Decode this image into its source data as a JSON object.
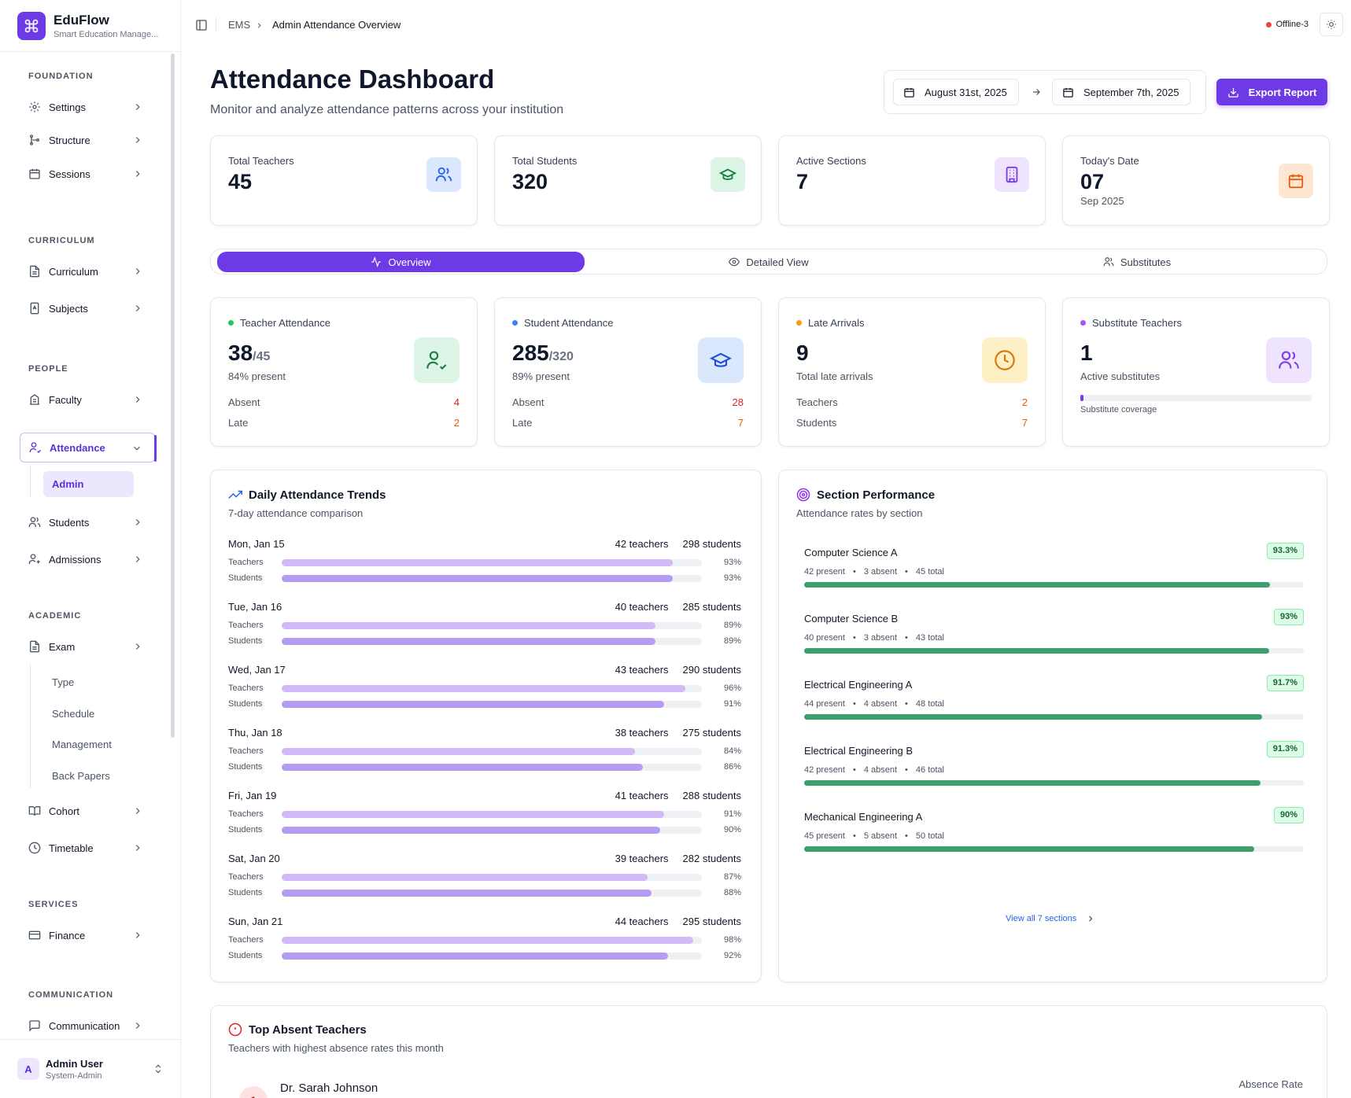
{
  "brand": {
    "name": "EduFlow",
    "subtitle": "Smart Education Manage..."
  },
  "sidebar": {
    "groups": [
      "FOUNDATION",
      "CURRICULUM",
      "PEOPLE",
      "ACADEMIC",
      "SERVICES",
      "COMMUNICATION"
    ],
    "items": {
      "settings": "Settings",
      "structure": "Structure",
      "sessions": "Sessions",
      "curriculum": "Curriculum",
      "subjects": "Subjects",
      "faculty": "Faculty",
      "attendance": "Attendance",
      "attendance_admin": "Admin",
      "students": "Students",
      "admissions": "Admissions",
      "exam": "Exam",
      "exam_type": "Type",
      "exam_schedule": "Schedule",
      "exam_management": "Management",
      "exam_back_papers": "Back Papers",
      "cohort": "Cohort",
      "timetable": "Timetable",
      "finance": "Finance",
      "communication": "Communication"
    },
    "user": {
      "initial": "A",
      "name": "Admin User",
      "role": "System-Admin"
    }
  },
  "topbar": {
    "breadcrumb": [
      "EMS",
      "Admin Attendance Overview"
    ],
    "status": "Offline-3"
  },
  "header": {
    "title": "Attendance Dashboard",
    "subtitle": "Monitor and analyze attendance patterns across your institution",
    "date_from": "August 31st, 2025",
    "date_to": "September 7th, 2025",
    "export_label": "Export Report"
  },
  "stats": [
    {
      "label": "Total Teachers",
      "value": "45"
    },
    {
      "label": "Total Students",
      "value": "320"
    },
    {
      "label": "Active Sections",
      "value": "7"
    },
    {
      "label": "Today's Date",
      "value": "07",
      "sub": "Sep 2025"
    }
  ],
  "tabs": [
    "Overview",
    "Detailed View",
    "Substitutes"
  ],
  "metrics": {
    "teacher": {
      "title": "Teacher Attendance",
      "value": "38",
      "total": "/45",
      "pct": "84% present",
      "absent_label": "Absent",
      "absent": "4",
      "late_label": "Late",
      "late": "2"
    },
    "student": {
      "title": "Student Attendance",
      "value": "285",
      "total": "/320",
      "pct": "89% present",
      "absent_label": "Absent",
      "absent": "28",
      "late_label": "Late",
      "late": "7"
    },
    "late": {
      "title": "Late Arrivals",
      "value": "9",
      "sub": "Total late arrivals",
      "teachers_label": "Teachers",
      "teachers": "2",
      "students_label": "Students",
      "students": "7"
    },
    "subs": {
      "title": "Substitute Teachers",
      "value": "1",
      "sub": "Active substitutes",
      "coverage_label": "Substitute coverage",
      "coverage": 0.012
    }
  },
  "trends": {
    "title": "Daily Attendance Trends",
    "subtitle": "7-day attendance comparison",
    "teachers_label": "Teachers",
    "students_label": "Students",
    "days": [
      {
        "day": "Mon, Jan 15",
        "teachers": "42 teachers",
        "students": "298 students",
        "tpct": 93,
        "spct": 93,
        "tpct_l": "93%",
        "spct_l": "93%"
      },
      {
        "day": "Tue, Jan 16",
        "teachers": "40 teachers",
        "students": "285 students",
        "tpct": 89,
        "spct": 89,
        "tpct_l": "89%",
        "spct_l": "89%"
      },
      {
        "day": "Wed, Jan 17",
        "teachers": "43 teachers",
        "students": "290 students",
        "tpct": 96,
        "spct": 91,
        "tpct_l": "96%",
        "spct_l": "91%"
      },
      {
        "day": "Thu, Jan 18",
        "teachers": "38 teachers",
        "students": "275 students",
        "tpct": 84,
        "spct": 86,
        "tpct_l": "84%",
        "spct_l": "86%"
      },
      {
        "day": "Fri, Jan 19",
        "teachers": "41 teachers",
        "students": "288 students",
        "tpct": 91,
        "spct": 90,
        "tpct_l": "91%",
        "spct_l": "90%"
      },
      {
        "day": "Sat, Jan 20",
        "teachers": "39 teachers",
        "students": "282 students",
        "tpct": 87,
        "spct": 88,
        "tpct_l": "87%",
        "spct_l": "88%"
      },
      {
        "day": "Sun, Jan 21",
        "teachers": "44 teachers",
        "students": "295 students",
        "tpct": 98,
        "spct": 92,
        "tpct_l": "98%",
        "spct_l": "92%"
      }
    ]
  },
  "sections": {
    "title": "Section Performance",
    "subtitle": "Attendance rates by section",
    "items": [
      {
        "name": "Computer Science A",
        "rate": "93.3%",
        "value": 93.3,
        "present": "42 present",
        "absent": "3 absent",
        "total": "45 total"
      },
      {
        "name": "Computer Science B",
        "rate": "93%",
        "value": 93,
        "present": "40 present",
        "absent": "3 absent",
        "total": "43 total"
      },
      {
        "name": "Electrical Engineering A",
        "rate": "91.7%",
        "value": 91.7,
        "present": "44 present",
        "absent": "4 absent",
        "total": "48 total"
      },
      {
        "name": "Electrical Engineering B",
        "rate": "91.3%",
        "value": 91.3,
        "present": "42 present",
        "absent": "4 absent",
        "total": "46 total"
      },
      {
        "name": "Mechanical Engineering A",
        "rate": "90%",
        "value": 90,
        "present": "45 present",
        "absent": "5 absent",
        "total": "50 total"
      }
    ],
    "view_all": "View all 7 sections"
  },
  "absent": {
    "title": "Top Absent Teachers",
    "subtitle": "Teachers with highest absence rates this month",
    "rank": "1",
    "name": "Dr. Sarah Johnson",
    "rate_label": "Absence Rate"
  },
  "colors": {
    "accent": "#6d3ae6",
    "success": "#3f9e6d",
    "danger": "#dc2626",
    "warning": "#ea580c"
  }
}
